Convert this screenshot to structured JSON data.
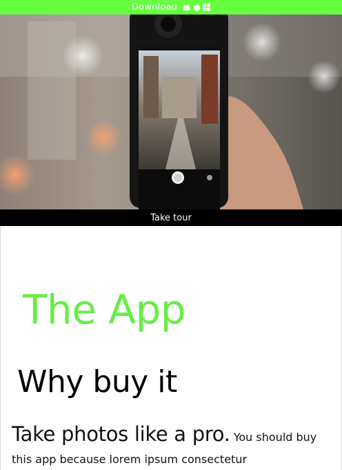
{
  "top_bar": {
    "download_label": "Download",
    "icons": [
      "android-icon",
      "apple-icon",
      "windows-icon"
    ],
    "background": "#66ff3f"
  },
  "hero": {
    "image": "photo of a hand holding a phone camera app over a city street"
  },
  "tour": {
    "label": "Take tour"
  },
  "main": {
    "app_title": "The App",
    "why_title": "Why buy it",
    "lead": "Take photos like a pro.",
    "body": " You should buy this app because lorem ipsum consectetur",
    "accent_color": "#66ee44"
  }
}
